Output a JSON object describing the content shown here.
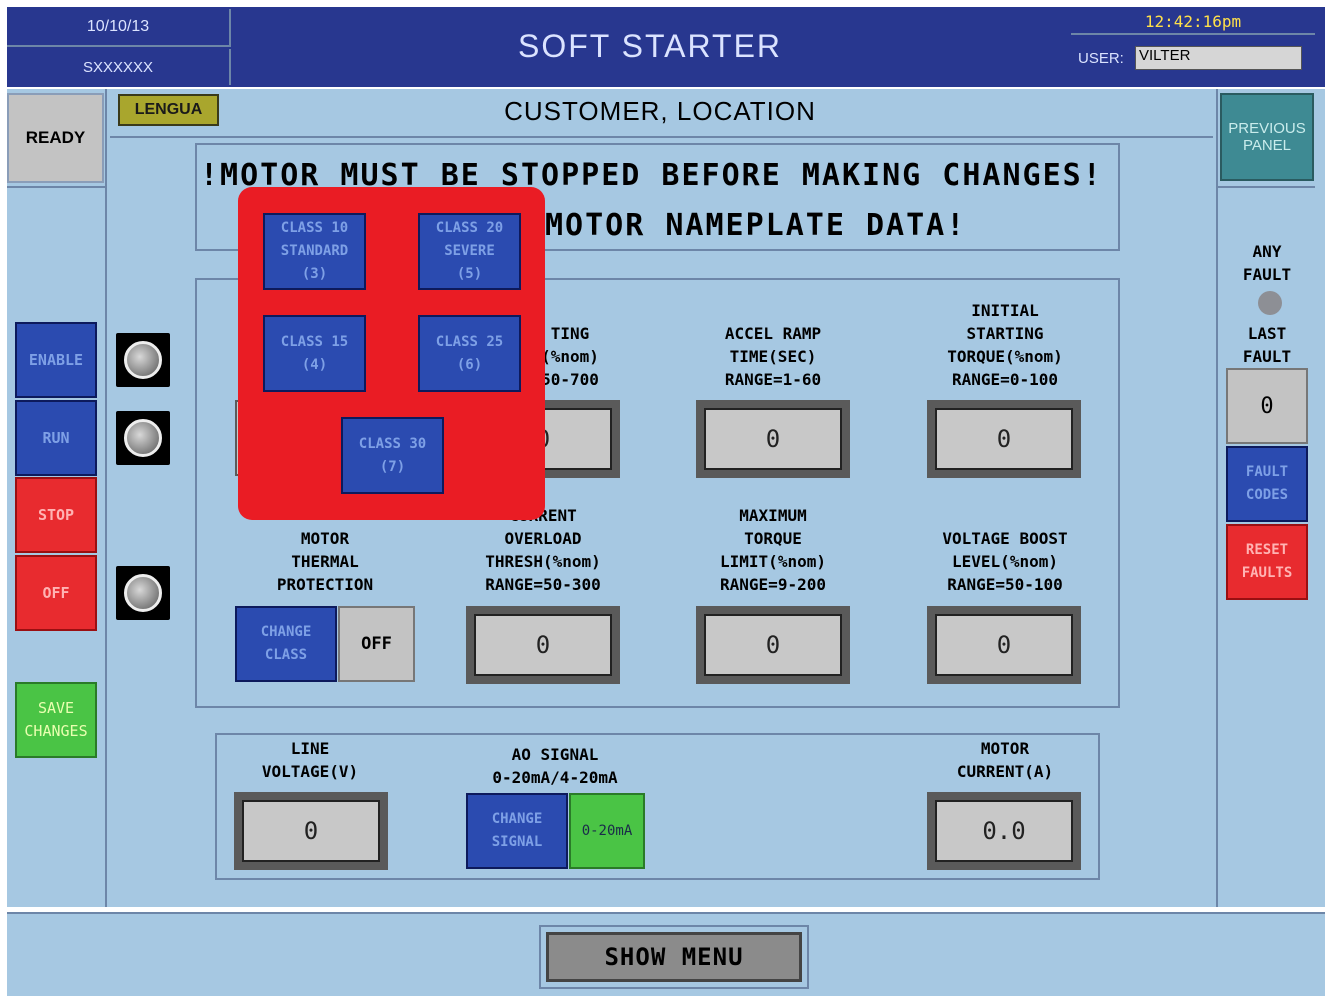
{
  "header": {
    "date": "10/10/13",
    "serial": "SXXXXXX",
    "title": "SOFT STARTER",
    "time": "12:42:16pm",
    "user_label": "USER:",
    "user_value": "VILTER"
  },
  "subheader": {
    "status": "READY",
    "lang_button": "LENGUA",
    "location": "CUSTOMER, LOCATION",
    "previous_panel": "PREVIOUS PANEL"
  },
  "warning": {
    "line1": "!MOTOR MUST BE STOPPED BEFORE MAKING CHANGES!",
    "line2_visible": "MOTOR NAMEPLATE DATA!"
  },
  "left_buttons": {
    "enable": "ENABLE",
    "run": "RUN",
    "stop": "STOP",
    "off": "OFF",
    "save": "SAVE\nCHANGES"
  },
  "right_panel": {
    "any_fault": "ANY\nFAULT",
    "last_fault": "LAST\nFAULT",
    "last_fault_value": "0",
    "fault_codes": "FAULT\nCODES",
    "reset_faults": "RESET\nFAULTS"
  },
  "params": {
    "starting_current_label": "TING\n(%nom)\n50-700",
    "starting_current_value": "0",
    "accel_label": "ACCEL RAMP\nTIME(SEC)\nRANGE=1-60",
    "accel_value": "0",
    "init_torque_label": "INITIAL\nSTARTING\nTORQUE(%nom)\nRANGE=0-100",
    "init_torque_value": "0",
    "motor_thermal_label": "MOTOR\nTHERMAL\nPROTECTION",
    "change_class": "CHANGE\nCLASS",
    "class_state": "OFF",
    "overload_label": "CURRENT\nOVERLOAD\nTHRESH(%nom)\nRANGE=50-300",
    "overload_value": "0",
    "max_torque_label": "MAXIMUM\nTORQUE\nLIMIT(%nom)\nRANGE=9-200",
    "max_torque_value": "0",
    "voltage_boost_label": "VOLTAGE BOOST\nLEVEL(%nom)\nRANGE=50-100",
    "voltage_boost_value": "0"
  },
  "bottom": {
    "line_voltage_label": "LINE\nVOLTAGE(V)",
    "line_voltage_value": "0",
    "ao_label": "AO SIGNAL\n0-20mA/4-20mA",
    "change_signal": "CHANGE\nSIGNAL",
    "signal_value": "0-20mA",
    "motor_current_label": "MOTOR\nCURRENT(A)",
    "motor_current_value": "0.0"
  },
  "popup": {
    "class10": "CLASS 10\nSTANDARD\n(3)",
    "class20": "CLASS 20\nSEVERE\n(5)",
    "class15": "CLASS 15\n(4)",
    "class25": "CLASS 25\n(6)",
    "class30": "CLASS 30\n(7)"
  },
  "footer": {
    "show_menu": "SHOW MENU"
  },
  "colors": {
    "header_blue": "#28378f",
    "panel_blue": "#a6c8e2",
    "popup_red": "#ea1c24",
    "button_blue": "#2b4bb0",
    "button_red": "#e82b2f",
    "button_green": "#4ac445"
  }
}
